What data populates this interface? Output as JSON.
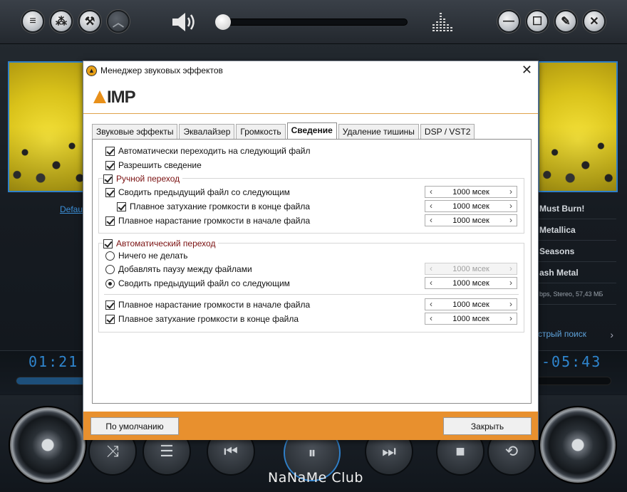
{
  "player": {
    "default_link": "Defau",
    "track_info": [
      "Must Burn!",
      "Metallica",
      "Seasons",
      "ash Metal",
      "bps, Stereo, 57,43 МБ"
    ],
    "quick_search": "стрый поиск",
    "time_elapsed": "01:21",
    "time_remaining": "-05:43",
    "progress_fraction": 0.27,
    "volume_fraction": 0.02,
    "brand": "NaNaMe Club",
    "icons": {
      "menu": "menu-icon",
      "fx": "effects-icon",
      "tools": "wrench-icon",
      "up": "chevron-up-icon",
      "speaker": "speaker-icon",
      "eq": "equalizer-icon",
      "minimize": "minimize-icon",
      "maximize": "maximize-icon",
      "pin": "pin-icon",
      "close": "close-icon"
    }
  },
  "dialog": {
    "title": "Менеджер звуковых эффектов",
    "logo_text": "IMP",
    "tabs": [
      {
        "label": "Звуковые эффекты",
        "active": false
      },
      {
        "label": "Эквалайзер",
        "active": false
      },
      {
        "label": "Громкость",
        "active": false
      },
      {
        "label": "Сведение",
        "active": true
      },
      {
        "label": "Удаление тишины",
        "active": false
      },
      {
        "label": "DSP / VST2",
        "active": false
      }
    ],
    "options": {
      "auto_next": {
        "label": "Автоматически переходить на следующий файл",
        "checked": true
      },
      "allow_mix": {
        "label": "Разрешить сведение",
        "checked": true
      }
    },
    "manual": {
      "label": "Ручной переход",
      "checked": true,
      "items": [
        {
          "label": "Сводить предыдущий файл со следующим",
          "checked": true,
          "value": "1000 мсек",
          "disabled": false
        },
        {
          "label": "Плавное затухание громкости в конце файла",
          "checked": true,
          "value": "1000 мсек",
          "disabled": false
        },
        {
          "label": "Плавное нарастание громкости в начале файла",
          "checked": true,
          "value": "1000 мсек",
          "disabled": false
        }
      ]
    },
    "auto": {
      "label": "Автоматический переход",
      "checked": true,
      "radios": [
        {
          "label": "Ничего не делать",
          "selected": false
        },
        {
          "label": "Добавлять паузу между файлами",
          "selected": false,
          "value": "1000 мсек",
          "disabled": true
        },
        {
          "label": "Сводить предыдущий файл со следующим",
          "selected": true,
          "value": "1000 мсек",
          "disabled": false
        }
      ],
      "items": [
        {
          "label": "Плавное нарастание громкости в начале файла",
          "checked": true,
          "value": "1000 мсек",
          "disabled": false
        },
        {
          "label": "Плавное затухание громкости в конце файла",
          "checked": true,
          "value": "1000 мсек",
          "disabled": false
        }
      ]
    },
    "buttons": {
      "defaults": "По умолчанию",
      "close": "Закрыть"
    },
    "accent_color": "#e8902e"
  }
}
